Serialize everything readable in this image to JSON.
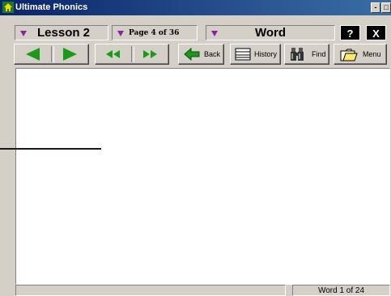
{
  "window": {
    "title": "Ultimate Phonics",
    "minimize": "-",
    "maximize": "□",
    "close": "x"
  },
  "selectors": {
    "lesson": "Lesson 2",
    "page": "Page 4  of  36",
    "word": "Word"
  },
  "buttons": {
    "help": "?",
    "exit": "X",
    "back": "Back",
    "history": "History",
    "find": "Find",
    "menu": "Menu"
  },
  "status": {
    "word_count": "Word  1 of 24"
  },
  "colors": {
    "title_bar": "#0a246a",
    "nav_arrow": "#1a9a1a",
    "dropdown_arrow": "#8b1fa8",
    "back_arrow": "#1a9a1a"
  },
  "icons": {
    "app": "house-icon",
    "back": "green-back-arrow-icon",
    "history": "stacked-papers-icon",
    "find": "binoculars-icon",
    "menu": "open-folder-icon"
  }
}
